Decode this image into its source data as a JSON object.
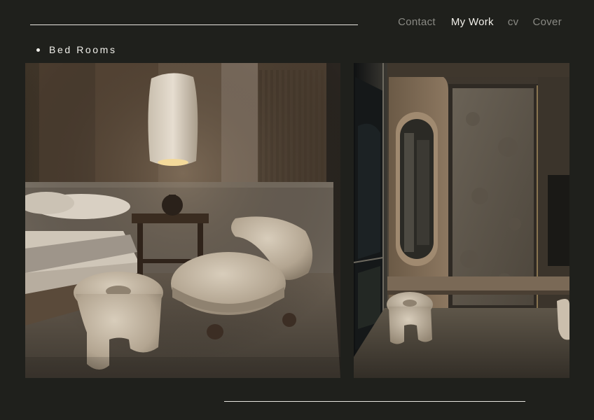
{
  "nav": {
    "items": [
      {
        "label": "Contact",
        "active": false
      },
      {
        "label": "My Work",
        "active": true
      },
      {
        "label": "cv",
        "active": false
      },
      {
        "label": "Cover",
        "active": false
      }
    ]
  },
  "section": {
    "title": "Bed Rooms"
  },
  "colors": {
    "background": "#1f201c",
    "text_active": "#f1efe9",
    "text_muted": "#8a8a84",
    "rule": "#e8e6e0"
  }
}
